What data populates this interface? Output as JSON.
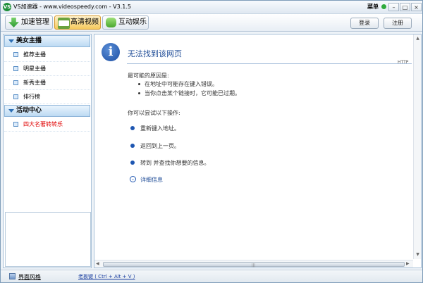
{
  "titlebar": {
    "title": "VS加速器 - www.videospeedy.com - V3.1.5",
    "logo_text": "VS",
    "menu_label": "菜单",
    "minimize": "–",
    "maximize": "□",
    "close": "×"
  },
  "toolbar": {
    "tabs": [
      {
        "label": "加速管理",
        "icon": "speed-arrow-icon"
      },
      {
        "label": "高清视频",
        "icon": "film-icon"
      },
      {
        "label": "互动娱乐",
        "icon": "gamepad-icon"
      }
    ],
    "login_label": "登录",
    "register_label": "注册"
  },
  "sidebar": {
    "cat1": "美女主播",
    "items1": [
      "推荐主播",
      "明星主播",
      "新秀主播",
      "排行榜"
    ],
    "cat2": "活动中心",
    "items2": [
      "四大名著转转乐"
    ]
  },
  "content": {
    "title": "无法找到该网页",
    "http_tag": "HTTP",
    "causes_header": "最可能的原因是:",
    "causes": [
      "在地址中可能存在键入错误。",
      "当你点击某个链接时，它可能已过期。"
    ],
    "try_header": "你可以尝试以下操作:",
    "actions": [
      "重新键入地址。",
      "返回到上一页。",
      "转到  并查找你想要的信息。"
    ],
    "details": "详细信息"
  },
  "statusbar": {
    "skin": "界面风格",
    "hotkey": "老板键 ( Ctrl + Alt + V )"
  },
  "colors": {
    "accent": "#1f4c97",
    "red_item": "#e00000",
    "active_tab": "#f6c95c"
  }
}
